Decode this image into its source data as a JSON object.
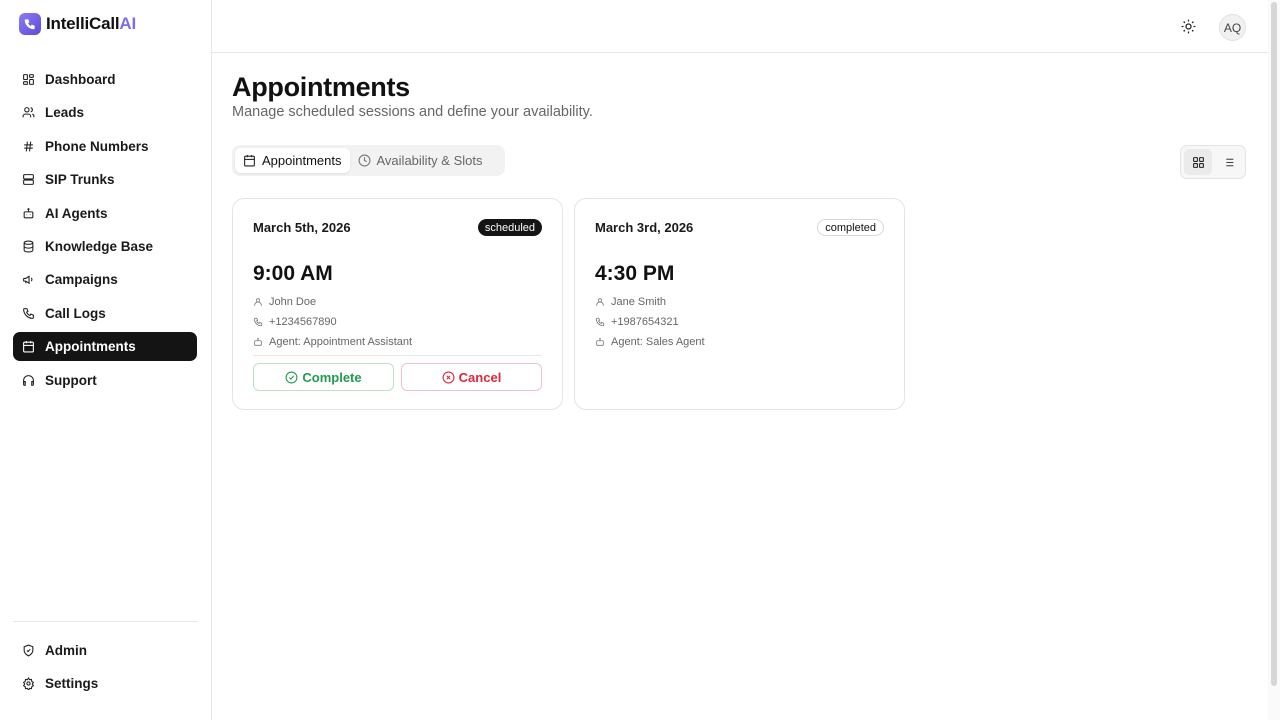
{
  "app": {
    "brand_main": "IntelliCall",
    "brand_accent": "AI",
    "accent_color": "#7c6cf0"
  },
  "sidebar": {
    "items": [
      {
        "label": "Dashboard",
        "icon": "grid-icon"
      },
      {
        "label": "Leads",
        "icon": "users-icon"
      },
      {
        "label": "Phone Numbers",
        "icon": "hash-icon"
      },
      {
        "label": "SIP Trunks",
        "icon": "server-icon"
      },
      {
        "label": "AI Agents",
        "icon": "bot-icon"
      },
      {
        "label": "Knowledge Base",
        "icon": "database-icon"
      },
      {
        "label": "Campaigns",
        "icon": "megaphone-icon"
      },
      {
        "label": "Call Logs",
        "icon": "phone-icon"
      },
      {
        "label": "Appointments",
        "icon": "calendar-icon",
        "active": true
      },
      {
        "label": "Support",
        "icon": "headphones-icon"
      }
    ],
    "bottom_items": [
      {
        "label": "Admin",
        "icon": "shield-icon"
      },
      {
        "label": "Settings",
        "icon": "gear-icon"
      }
    ]
  },
  "topbar": {
    "theme_icon": "sun-icon",
    "avatar_initials": "AQ"
  },
  "main": {
    "title": "Appointments",
    "subtitle": "Manage scheduled sessions and define your availability.",
    "tabs": [
      {
        "label": "Appointments",
        "icon": "calendar-icon",
        "active": true
      },
      {
        "label": "Availability & Slots",
        "icon": "clock-icon",
        "active": false
      }
    ],
    "view_modes": [
      {
        "icon": "grid-view-icon",
        "active": true
      },
      {
        "icon": "list-view-icon",
        "active": false
      }
    ],
    "appointments": [
      {
        "date": "March 5th, 2026",
        "status": "scheduled",
        "time": "9:00 AM",
        "name": "John Doe",
        "phone": "+1234567890",
        "agent": "Agent: Appointment Assistant",
        "actions": {
          "complete": "Complete",
          "cancel": "Cancel"
        }
      },
      {
        "date": "March 3rd, 2026",
        "status": "completed",
        "time": "4:30 PM",
        "name": "Jane Smith",
        "phone": "+1987654321",
        "agent": "Agent: Sales Agent"
      }
    ]
  },
  "colors": {
    "complete": "#1f9d4d",
    "cancel": "#e0243d",
    "active_nav": "#141414"
  }
}
